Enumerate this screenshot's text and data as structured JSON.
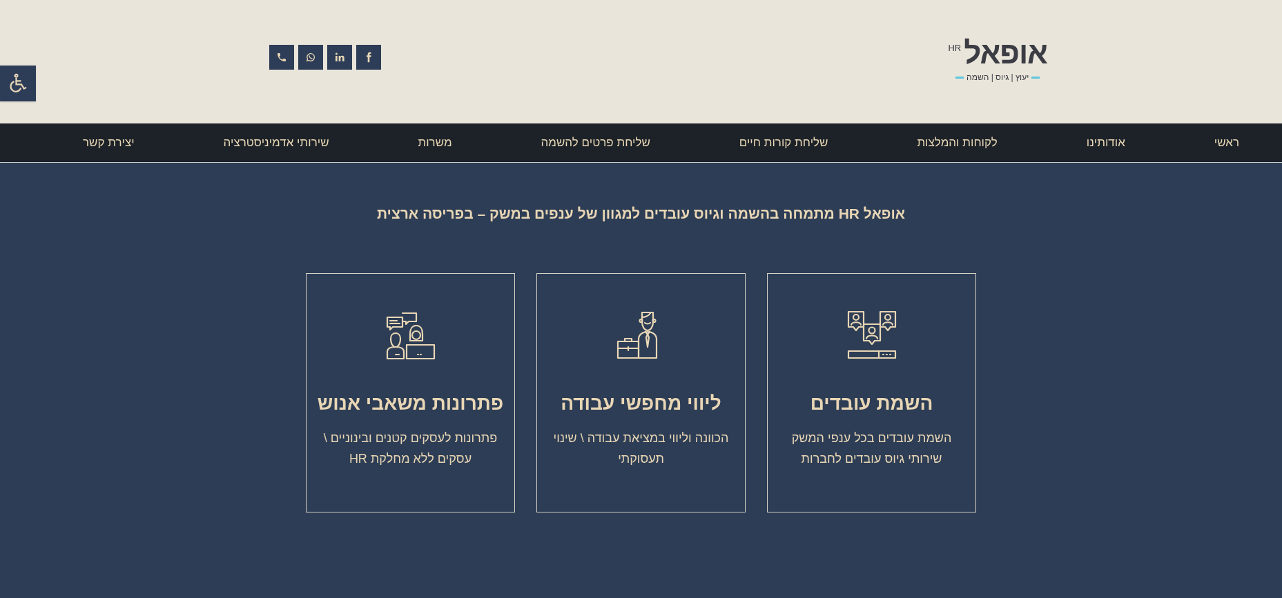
{
  "logo": {
    "name": "אופאל",
    "suffix": "HR",
    "tagline": "יעוץ | גיוס | השמה"
  },
  "social_links": [
    {
      "kind": "phone"
    },
    {
      "kind": "whatsapp"
    },
    {
      "kind": "linkedin"
    },
    {
      "kind": "facebook"
    }
  ],
  "nav": [
    {
      "label": "ראשי"
    },
    {
      "label": "אודותינו"
    },
    {
      "label": "לקוחות והמלצות"
    },
    {
      "label": "שליחת קורות חיים"
    },
    {
      "label": "שליחת פרטים להשמה"
    },
    {
      "label": "משרות"
    },
    {
      "label": "שירותי אדמיניסטרציה"
    },
    {
      "label": "יצירת קשר"
    }
  ],
  "headline": "אופאל HR מתמחה בהשמה וגיוס עובדים למגוון של ענפים במשק – בפריסה ארצית",
  "services": [
    {
      "kind": "placement",
      "title": "השמת עובדים",
      "lines": [
        "השמת עובדים בכל ענפי המשק",
        "שירותי גיוס עובדים לחברות"
      ]
    },
    {
      "kind": "career",
      "title": "ליווי מחפשי עבודה",
      "lines": [
        "הכוונה וליווי במציאת עבודה \\ שינוי",
        "תעסוקתי"
      ]
    },
    {
      "kind": "solutions",
      "title": "פתרונות משאבי אנוש",
      "lines": [
        "פתרונות לעסקים קטנים ובינוניים \\",
        "עסקים ללא מחלקת HR"
      ]
    }
  ]
}
